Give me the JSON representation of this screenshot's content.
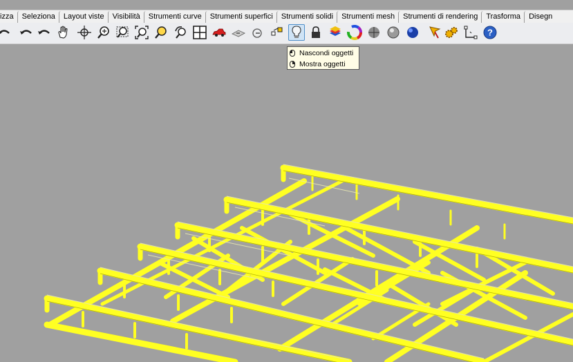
{
  "tabs": [
    "izza",
    "Seleziona",
    "Layout viste",
    "Visibilità",
    "Strumenti curve",
    "Strumenti superfici",
    "Strumenti solidi",
    "Strumenti mesh",
    "Strumenti di rendering",
    "Trasforma",
    "Disegn"
  ],
  "tooltip": {
    "left_click": "Nascondi oggetti",
    "right_click": "Mostra oggetti"
  },
  "colors": {
    "structure": "#ffff22",
    "structure_edge": "#b5b500",
    "viewport_bg": "#a0a0a0",
    "toolbar_bg": "#ecedf0"
  },
  "toolbar_icons": [
    "undo-view-icon",
    "redo-icon",
    "undo-icon",
    "pan-hand-icon",
    "rotate-view-icon",
    "zoom-icon",
    "zoom-window-icon",
    "zoom-extents-icon",
    "zoom-selected-icon",
    "zoom-target-icon",
    "four-viewports-icon",
    "car-shaded-icon",
    "plane-icon",
    "circle-center-icon",
    "points-icon",
    "lightbulb-hide-icon",
    "lock-icon",
    "layer-icon",
    "color-wheel-icon",
    "sphere-shaded-icon",
    "sphere-rendered-icon",
    "sphere-blue-icon",
    "pointer-pin-icon",
    "gear-cogs-icon",
    "dimension-icon",
    "help-icon"
  ]
}
